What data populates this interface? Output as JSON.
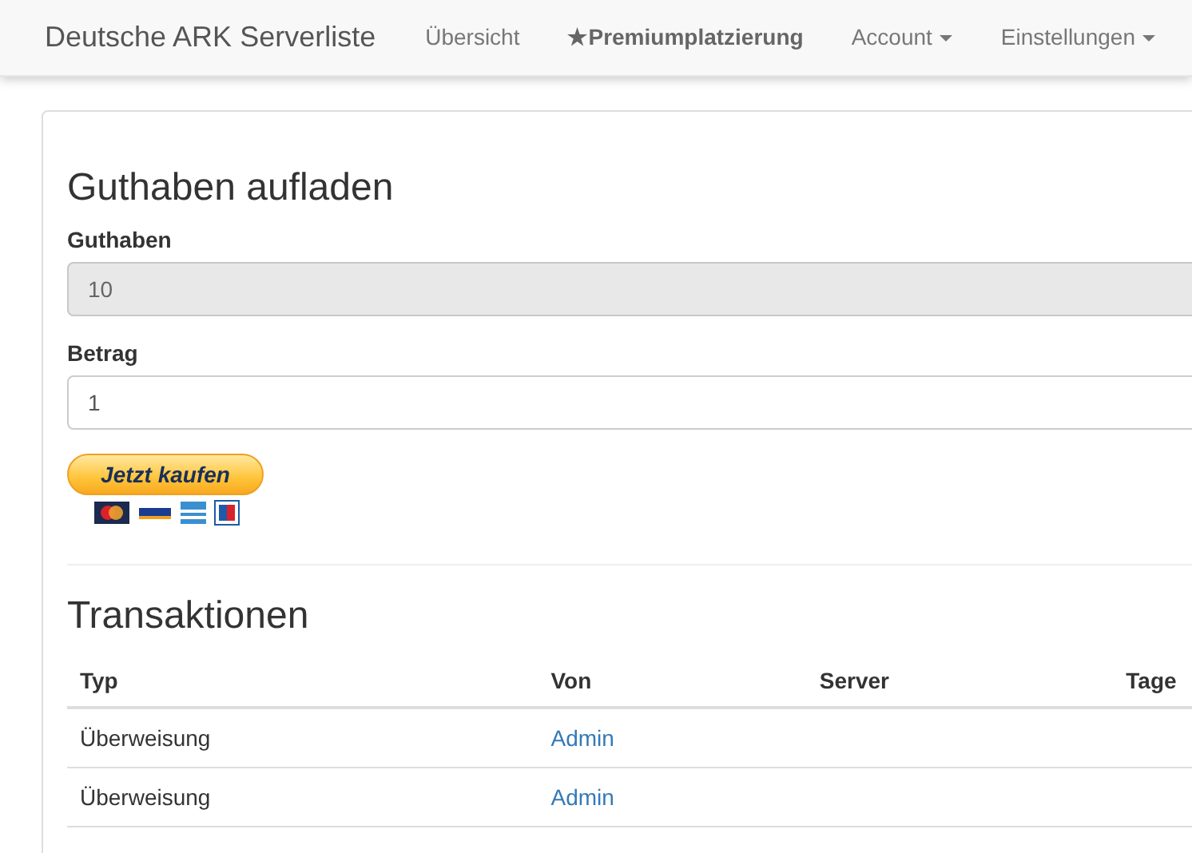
{
  "navbar": {
    "brand": "Deutsche ARK Serverliste",
    "items": [
      {
        "label": "Übersicht",
        "kind": "link",
        "bold": false
      },
      {
        "label": "★Premiumplatzierung",
        "kind": "link",
        "bold": true
      },
      {
        "label": "Account",
        "kind": "dropdown",
        "bold": false
      },
      {
        "label": "Einstellungen",
        "kind": "dropdown",
        "bold": false
      }
    ]
  },
  "topup": {
    "title": "Guthaben aufladen",
    "fields": [
      {
        "label": "Guthaben",
        "value": "10",
        "disabled": true
      },
      {
        "label": "Betrag",
        "value": "1",
        "disabled": false
      }
    ],
    "buy_button": "Jetzt kaufen"
  },
  "transactions": {
    "title": "Transaktionen",
    "columns": [
      "Typ",
      "Von",
      "Server",
      "Tage"
    ],
    "rows": [
      [
        "Überweisung",
        "Admin",
        "",
        ""
      ],
      [
        "Überweisung",
        "Admin",
        "",
        ""
      ]
    ]
  }
}
